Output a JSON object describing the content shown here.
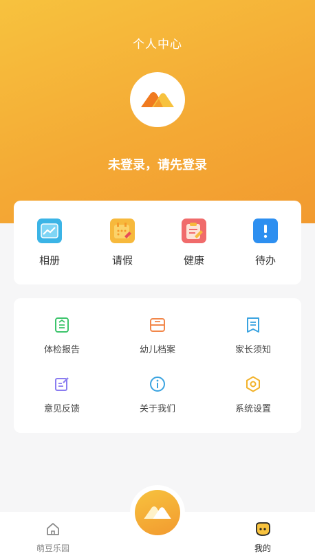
{
  "header": {
    "title": "个人中心",
    "login_prompt": "未登录，请先登录",
    "brand_colors": [
      "#f7c23e",
      "#f29a2f"
    ]
  },
  "quick_actions": [
    {
      "label": "相册",
      "icon": "photo-album-icon",
      "color": "#3bb4e6"
    },
    {
      "label": "请假",
      "icon": "leave-calendar-icon",
      "color": "#f7b93c"
    },
    {
      "label": "健康",
      "icon": "health-clipboard-icon",
      "color": "#f06b6b"
    },
    {
      "label": "待办",
      "icon": "todo-alert-icon",
      "color": "#2d8ff0"
    }
  ],
  "menu": [
    {
      "label": "体检报告",
      "icon": "report-icon",
      "color": "#3cc46b"
    },
    {
      "label": "幼儿档案",
      "icon": "archive-icon",
      "color": "#f2874a"
    },
    {
      "label": "家长须知",
      "icon": "notice-book-icon",
      "color": "#3aa3e0"
    },
    {
      "label": "意见反馈",
      "icon": "feedback-icon",
      "color": "#8a7cf0"
    },
    {
      "label": "关于我们",
      "icon": "info-icon",
      "color": "#3aa3e0"
    },
    {
      "label": "系统设置",
      "icon": "settings-gear-icon",
      "color": "#f2b22a"
    }
  ],
  "tabbar": {
    "home_label": "萌豆乐园",
    "mine_label": "我的",
    "active": "我的"
  }
}
